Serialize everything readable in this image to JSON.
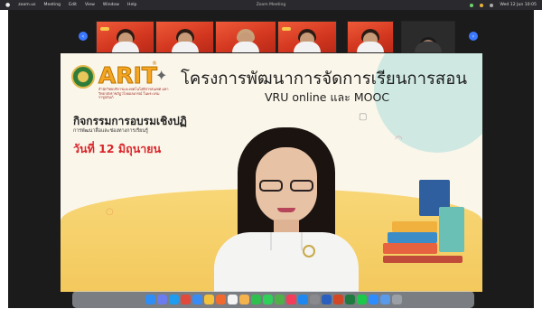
{
  "menubar": {
    "items": [
      "zoom.us",
      "Meeting",
      "Edit",
      "View",
      "Window",
      "Help"
    ],
    "window_title": "Zoom Meeting",
    "right_items": [
      "Wed 12 Jun 10:05"
    ]
  },
  "meeting": {
    "gallery_prev_icon": "chevron-left-icon",
    "gallery_next_icon": "chevron-right-icon",
    "participants": [
      {
        "style": "red",
        "hair": "dark"
      },
      {
        "style": "red",
        "hair": "dark"
      },
      {
        "style": "red",
        "hair": "blonde"
      },
      {
        "style": "red",
        "hair": "dark"
      },
      {
        "style": "red",
        "hair": "dark"
      },
      {
        "style": "dark",
        "hair": "dark"
      }
    ]
  },
  "slide": {
    "logo_text": "ARIT",
    "logo_sup": "®",
    "logo_sub": "สำนักวิทยบริการและเทคโนโลยีสารสนเทศ มหาวิทยาลัยราชภัฏวไลยอลงกรณ์ ในพระบรมราชูปถัมภ์",
    "title": "โครงการพัฒนาการจัดการเรียนการสอน",
    "subtitle": "VRU online และ MOOC",
    "activity": "กิจกรรมการอบรมเชิงปฏิ",
    "activity_sub": "การพัฒนาสื่อและช่องทางการเรียนรู้",
    "date": "วันที่ 12 มิถุนายน",
    "colors": {
      "accent": "#f5a623",
      "date": "#d9262a",
      "wave": "#f8d777"
    }
  },
  "dock": {
    "icons": [
      {
        "name": "finder-icon",
        "color": "#2f8ef5"
      },
      {
        "name": "launchpad-icon",
        "color": "#6b7cf0"
      },
      {
        "name": "safari-icon",
        "color": "#1f9bf0"
      },
      {
        "name": "chrome-icon",
        "color": "#e04a3c"
      },
      {
        "name": "mail-icon",
        "color": "#3a8cf5"
      },
      {
        "name": "notes-icon",
        "color": "#f3c13b"
      },
      {
        "name": "reminders-icon",
        "color": "#f06a2f"
      },
      {
        "name": "calendar-icon",
        "color": "#f4f4f4"
      },
      {
        "name": "photos-icon",
        "color": "#f5b34d"
      },
      {
        "name": "facetime-icon",
        "color": "#2fbf4f"
      },
      {
        "name": "messages-icon",
        "color": "#2fcf5a"
      },
      {
        "name": "maps-icon",
        "color": "#4fb04a"
      },
      {
        "name": "music-icon",
        "color": "#f23c5a"
      },
      {
        "name": "appstore-icon",
        "color": "#1e88f0"
      },
      {
        "name": "settings-icon",
        "color": "#8a8a8e"
      },
      {
        "name": "word-icon",
        "color": "#2a5fc0"
      },
      {
        "name": "powerpoint-icon",
        "color": "#d24726"
      },
      {
        "name": "excel-icon",
        "color": "#1f7a3f"
      },
      {
        "name": "line-icon",
        "color": "#1cc84a"
      },
      {
        "name": "zoom-icon",
        "color": "#2d8cff"
      },
      {
        "name": "preview-icon",
        "color": "#5a9ae8"
      },
      {
        "name": "trash-icon",
        "color": "#9aa0a6"
      }
    ]
  }
}
